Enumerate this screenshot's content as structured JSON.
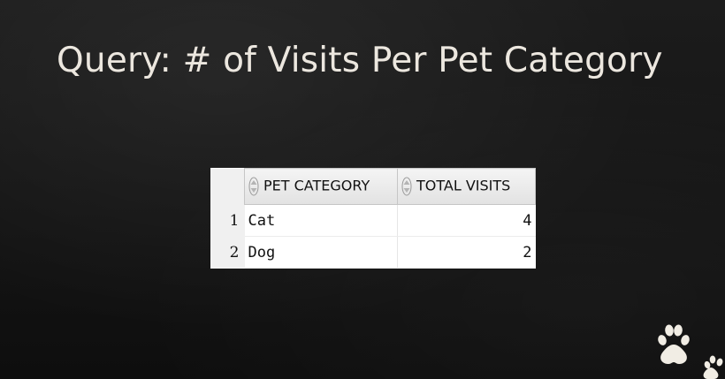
{
  "slide": {
    "title": "Query: # of Visits Per Pet Category"
  },
  "result_grid": {
    "columns": [
      {
        "label": "PET CATEGORY",
        "icon": "sort-icon"
      },
      {
        "label": "TOTAL VISITS",
        "icon": "sort-icon"
      }
    ],
    "rows": [
      {
        "num": "1",
        "category": "Cat",
        "visits": "4"
      },
      {
        "num": "2",
        "category": "Dog",
        "visits": "2"
      }
    ]
  },
  "decoration": {
    "icon": "paw-print-icon",
    "color": "#f1ede4"
  }
}
